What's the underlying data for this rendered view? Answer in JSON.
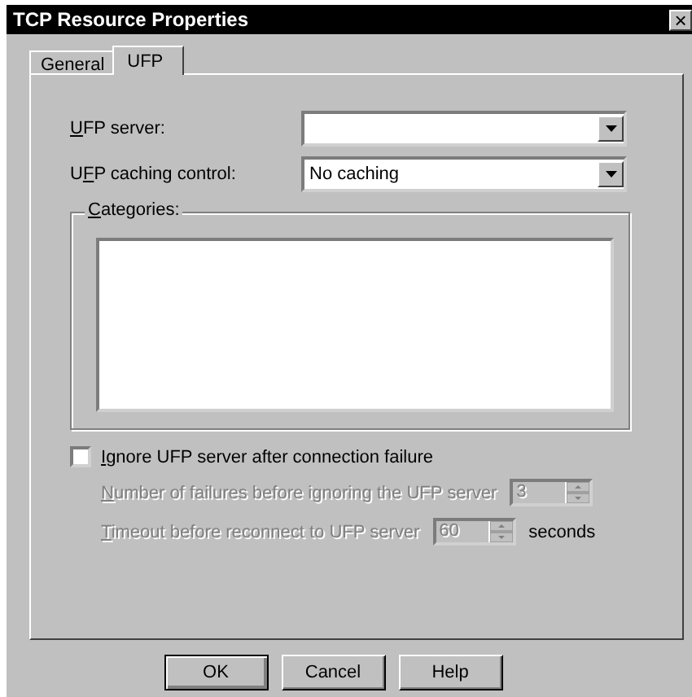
{
  "window": {
    "title": "TCP Resource Properties",
    "close": "×"
  },
  "tabs": [
    {
      "label": "General",
      "selected": false
    },
    {
      "label": "UFP",
      "selected": true
    }
  ],
  "fields": [
    {
      "label": {
        "key": "U",
        "after": "FP server:"
      }
    },
    {
      "label": {
        "before": "U",
        "key": "F",
        "after": "P caching control:"
      },
      "value": "No caching"
    }
  ],
  "categories": {
    "label": {
      "key": "C",
      "after": "ategories:"
    }
  },
  "ignore_checkbox": {
    "label": {
      "key": "I",
      "after": "gnore UFP server after connection failure"
    },
    "checked": false
  },
  "spinners": [
    {
      "label": {
        "key": "N",
        "after": "umber of failures before ignoring the UFP server"
      },
      "value": "3",
      "disabled": true
    },
    {
      "label": {
        "key": "T",
        "after": "imeout before reconnect to UFP server"
      },
      "value": "60",
      "disabled": true,
      "unit": "seconds"
    }
  ],
  "buttons": [
    "OK",
    "Cancel",
    "Help"
  ]
}
